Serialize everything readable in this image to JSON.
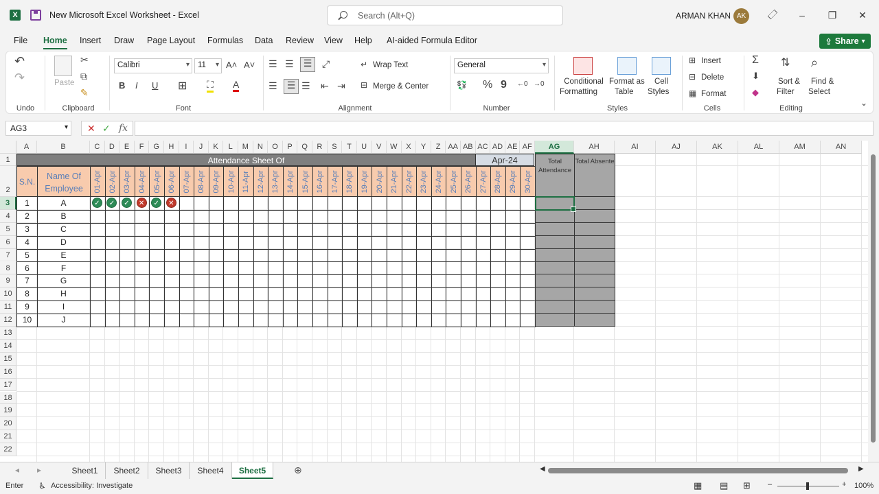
{
  "titlebar": {
    "doc_title": "New Microsoft Excel Worksheet  -  Excel",
    "search_placeholder": "Search (Alt+Q)",
    "user_name": "ARMAN KHAN",
    "avatar_initials": "AK"
  },
  "menu": {
    "tabs": [
      "File",
      "Home",
      "Insert",
      "Draw",
      "Page Layout",
      "Formulas",
      "Data",
      "Review",
      "View",
      "Help",
      "AI-aided Formula Editor"
    ],
    "active": "Home",
    "share_label": "Share"
  },
  "ribbon": {
    "undo_label": "Undo",
    "clipboard_label": "Clipboard",
    "paste_label": "Paste",
    "font_label": "Font",
    "font_name": "Calibri",
    "font_size": "11",
    "alignment_label": "Alignment",
    "wrap_text": "Wrap Text",
    "merge_center": "Merge & Center",
    "number_label": "Number",
    "number_format": "General",
    "styles_label": "Styles",
    "conditional_formatting": [
      "Conditional",
      "Formatting"
    ],
    "format_as_table": [
      "Format as",
      "Table"
    ],
    "cell_styles": [
      "Cell",
      "Styles"
    ],
    "cells_label": "Cells",
    "insert": "Insert",
    "delete": "Delete",
    "format": "Format",
    "editing_label": "Editing",
    "sort_filter": [
      "Sort &",
      "Filter"
    ],
    "find_select": [
      "Find &",
      "Select"
    ]
  },
  "formula_bar": {
    "name_box": "AG3",
    "formula": ""
  },
  "columns": [
    "A",
    "B",
    "C",
    "D",
    "E",
    "F",
    "G",
    "H",
    "I",
    "J",
    "K",
    "L",
    "M",
    "N",
    "O",
    "P",
    "Q",
    "R",
    "S",
    "T",
    "U",
    "V",
    "W",
    "X",
    "Y",
    "Z",
    "AA",
    "AB",
    "AC",
    "AD",
    "AE",
    "AF",
    "AG",
    "AH",
    "AI",
    "AJ",
    "AK",
    "AL",
    "AM",
    "AN"
  ],
  "selected_column": "AG",
  "selected_row": "3",
  "rows": [
    "1",
    "2",
    "3",
    "4",
    "5",
    "6",
    "7",
    "8",
    "9",
    "10",
    "11",
    "12",
    "13",
    "14",
    "15",
    "16",
    "17",
    "18",
    "19",
    "20",
    "21",
    "22"
  ],
  "sheet": {
    "title": "Attendance Sheet Of",
    "month": "Apr-24",
    "sn_header": "S.N.",
    "name_header": "Name Of Employee",
    "total_attendance_header": "Total Attendance",
    "total_absente_header": "Total Absente",
    "dates": [
      "01-Apr",
      "02-Apr",
      "03-Apr",
      "04-Apr",
      "05-Apr",
      "06-Apr",
      "07-Apr",
      "08-Apr",
      "09-Apr",
      "10-Apr",
      "11-Apr",
      "12-Apr",
      "13-Apr",
      "14-Apr",
      "15-Apr",
      "16-Apr",
      "17-Apr",
      "18-Apr",
      "19-Apr",
      "20-Apr",
      "21-Apr",
      "22-Apr",
      "23-Apr",
      "24-Apr",
      "25-Apr",
      "26-Apr",
      "27-Apr",
      "28-Apr",
      "29-Apr",
      "30-Apr"
    ],
    "employees": [
      {
        "sn": "1",
        "name": "A",
        "marks": [
          "present",
          "present",
          "present",
          "absent",
          "present",
          "absent"
        ]
      },
      {
        "sn": "2",
        "name": "B",
        "marks": []
      },
      {
        "sn": "3",
        "name": "C",
        "marks": []
      },
      {
        "sn": "4",
        "name": "D",
        "marks": []
      },
      {
        "sn": "5",
        "name": "E",
        "marks": []
      },
      {
        "sn": "6",
        "name": "F",
        "marks": []
      },
      {
        "sn": "7",
        "name": "G",
        "marks": []
      },
      {
        "sn": "8",
        "name": "H",
        "marks": []
      },
      {
        "sn": "9",
        "name": "I",
        "marks": []
      },
      {
        "sn": "10",
        "name": "J",
        "marks": []
      }
    ]
  },
  "sheet_tabs": [
    "Sheet1",
    "Sheet2",
    "Sheet3",
    "Sheet4",
    "Sheet5"
  ],
  "active_sheet": "Sheet5",
  "status": {
    "mode": "Enter",
    "accessibility": "Accessibility: Investigate",
    "zoom": "100%"
  },
  "colors": {
    "excel_green": "#1d6f42",
    "header_peach": "#f8cbad",
    "title_grey": "#7f7f7f",
    "total_grey": "#a6a6a6",
    "present": "#2e8b57",
    "absent": "#c0392b"
  }
}
